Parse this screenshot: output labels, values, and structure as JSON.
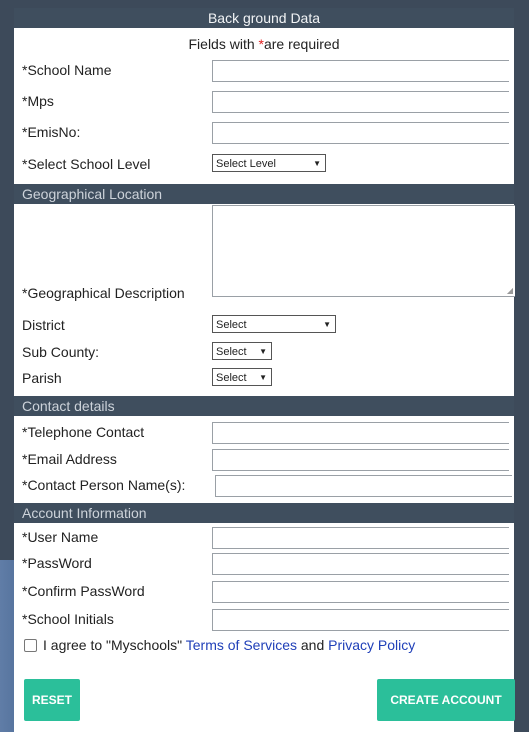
{
  "form": {
    "title": "Back ground Data",
    "required_note_prefix": "Fields with ",
    "required_note_star": "*",
    "required_note_suffix": "are required"
  },
  "sections": {
    "geo": "Geographical Location",
    "contact": "Contact details",
    "account": "Account Information"
  },
  "fields": {
    "school_name": "*School Name",
    "mps": "*Mps",
    "emis": "*EmisNo:",
    "school_level": "*Select School Level",
    "school_level_value": "Select Level",
    "geo_description": "*Geographical Description",
    "district": "District",
    "district_value": "Select",
    "sub_county": "Sub County:",
    "sub_county_value": "Select",
    "parish": "Parish",
    "parish_value": "Select",
    "telephone": "*Telephone Contact",
    "email": "*Email Address",
    "contact_person": "*Contact Person Name(s):",
    "username": "*User Name",
    "password": "*PassWord",
    "confirm_password": "*Confirm PassWord",
    "school_initials": "*School Initials"
  },
  "agreement": {
    "prefix": "I agree to \"Myschools\" ",
    "terms": "Terms of Services",
    "and": " and ",
    "privacy": "Privacy Policy"
  },
  "buttons": {
    "reset": "RESET",
    "create": "CREATE ACCOUNT"
  },
  "colors": {
    "header_bg": "#3f4e5e",
    "button": "#2bbf9a",
    "link": "#1f3fb8",
    "required_star": "#e02020"
  }
}
